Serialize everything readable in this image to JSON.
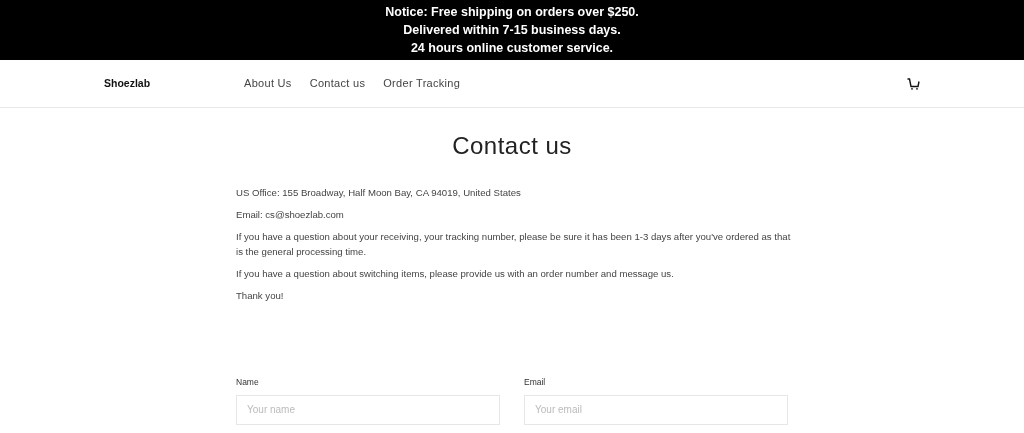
{
  "notice": [
    "Notice: Free shipping on orders over $250.",
    "Delivered within 7-15 business days.",
    "24 hours online customer service."
  ],
  "header": {
    "logo": "Shoezlab",
    "nav": [
      {
        "label": "About Us"
      },
      {
        "label": "Contact us"
      },
      {
        "label": "Order Tracking"
      }
    ]
  },
  "page": {
    "title": "Contact us",
    "paragraphs": [
      "US Office: 155 Broadway, Half Moon Bay, CA 94019, United States",
      "Email: cs@shoezlab.com",
      "If you have a question about your receiving, your tracking number, please be sure it has been 1-3 days after you've ordered as that is the general processing time.",
      "If you have a question about switching items, please provide us with an order number and message us.",
      "Thank you!"
    ]
  },
  "form": {
    "fields": [
      {
        "label": "Name",
        "placeholder": "Your name"
      },
      {
        "label": "Email",
        "placeholder": "Your email"
      }
    ]
  }
}
